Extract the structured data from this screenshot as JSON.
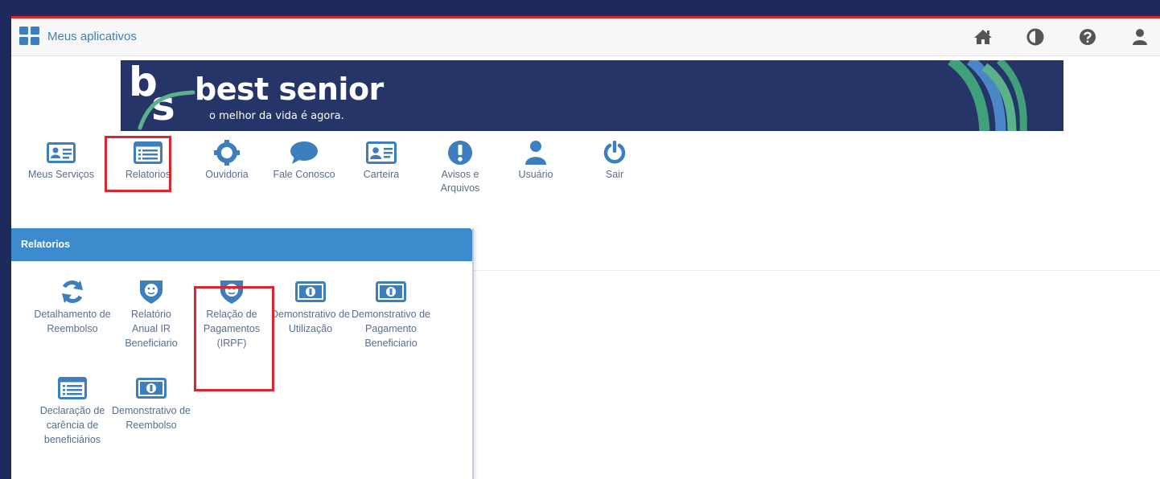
{
  "topbar": {
    "apps_label": "Meus aplicativos",
    "icons": [
      "home-icon",
      "contrast-icon",
      "help-icon",
      "user-icon"
    ]
  },
  "banner": {
    "logo_b": "b",
    "logo_s": "s",
    "brand": "best senior",
    "tagline": "o melhor da vida é agora."
  },
  "nav": {
    "items": [
      {
        "label": "Meus Serviços",
        "icon": "id-card-icon"
      },
      {
        "label": "Relatorios",
        "icon": "list-icon"
      },
      {
        "label": "Ouvidoria",
        "icon": "lifebuoy-icon"
      },
      {
        "label": "Fale Conosco",
        "icon": "chat-icon"
      },
      {
        "label": "Carteira",
        "icon": "id-card-icon"
      },
      {
        "label": "Avisos e Arquivos",
        "icon": "alert-icon"
      },
      {
        "label": "Usuário",
        "icon": "user-icon"
      },
      {
        "label": "Sair",
        "icon": "power-icon"
      }
    ]
  },
  "panel": {
    "title": "Relatorios",
    "items": [
      {
        "label": "Detalhamento de Reembolso",
        "icon": "refresh-icon"
      },
      {
        "label": "Relatório Anual IR Beneficiario",
        "icon": "lion-shield-icon"
      },
      {
        "label": "Relação de Pagamentos (IRPF)",
        "icon": "lion-shield-icon"
      },
      {
        "label": "Demonstrativo de Utilização",
        "icon": "money-icon"
      },
      {
        "label": "Demonstrativo de Pagamento Beneficiario",
        "icon": "money-icon"
      },
      {
        "label": "Declaração de carência de beneficiários",
        "icon": "list-icon"
      },
      {
        "label": "Demonstrativo de Reembolso",
        "icon": "money-icon"
      }
    ]
  },
  "colors": {
    "frame": "#1f2a5c",
    "accent_red": "#d9262f",
    "icon_blue": "#3d7fbe",
    "panel_header": "#3d8bcd",
    "banner_bg": "#263567"
  }
}
